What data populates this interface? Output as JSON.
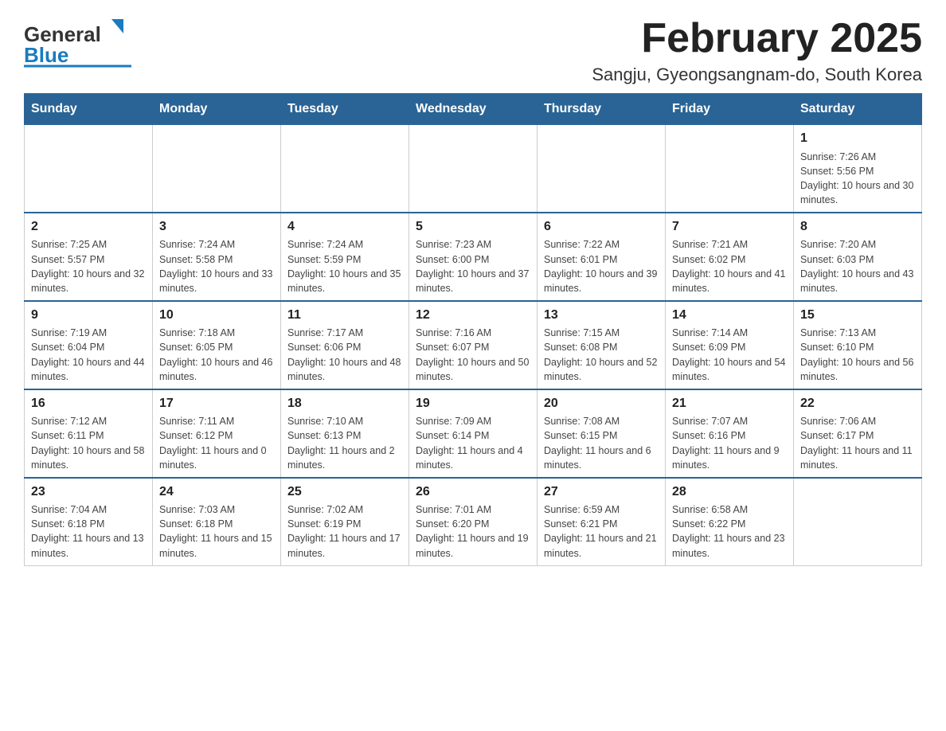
{
  "header": {
    "logo_general": "General",
    "logo_blue": "Blue",
    "title": "February 2025",
    "subtitle": "Sangju, Gyeongsangnam-do, South Korea"
  },
  "days_of_week": [
    "Sunday",
    "Monday",
    "Tuesday",
    "Wednesday",
    "Thursday",
    "Friday",
    "Saturday"
  ],
  "weeks": [
    {
      "days": [
        {
          "number": "",
          "sunrise": "",
          "sunset": "",
          "daylight": ""
        },
        {
          "number": "",
          "sunrise": "",
          "sunset": "",
          "daylight": ""
        },
        {
          "number": "",
          "sunrise": "",
          "sunset": "",
          "daylight": ""
        },
        {
          "number": "",
          "sunrise": "",
          "sunset": "",
          "daylight": ""
        },
        {
          "number": "",
          "sunrise": "",
          "sunset": "",
          "daylight": ""
        },
        {
          "number": "",
          "sunrise": "",
          "sunset": "",
          "daylight": ""
        },
        {
          "number": "1",
          "sunrise": "Sunrise: 7:26 AM",
          "sunset": "Sunset: 5:56 PM",
          "daylight": "Daylight: 10 hours and 30 minutes."
        }
      ]
    },
    {
      "days": [
        {
          "number": "2",
          "sunrise": "Sunrise: 7:25 AM",
          "sunset": "Sunset: 5:57 PM",
          "daylight": "Daylight: 10 hours and 32 minutes."
        },
        {
          "number": "3",
          "sunrise": "Sunrise: 7:24 AM",
          "sunset": "Sunset: 5:58 PM",
          "daylight": "Daylight: 10 hours and 33 minutes."
        },
        {
          "number": "4",
          "sunrise": "Sunrise: 7:24 AM",
          "sunset": "Sunset: 5:59 PM",
          "daylight": "Daylight: 10 hours and 35 minutes."
        },
        {
          "number": "5",
          "sunrise": "Sunrise: 7:23 AM",
          "sunset": "Sunset: 6:00 PM",
          "daylight": "Daylight: 10 hours and 37 minutes."
        },
        {
          "number": "6",
          "sunrise": "Sunrise: 7:22 AM",
          "sunset": "Sunset: 6:01 PM",
          "daylight": "Daylight: 10 hours and 39 minutes."
        },
        {
          "number": "7",
          "sunrise": "Sunrise: 7:21 AM",
          "sunset": "Sunset: 6:02 PM",
          "daylight": "Daylight: 10 hours and 41 minutes."
        },
        {
          "number": "8",
          "sunrise": "Sunrise: 7:20 AM",
          "sunset": "Sunset: 6:03 PM",
          "daylight": "Daylight: 10 hours and 43 minutes."
        }
      ]
    },
    {
      "days": [
        {
          "number": "9",
          "sunrise": "Sunrise: 7:19 AM",
          "sunset": "Sunset: 6:04 PM",
          "daylight": "Daylight: 10 hours and 44 minutes."
        },
        {
          "number": "10",
          "sunrise": "Sunrise: 7:18 AM",
          "sunset": "Sunset: 6:05 PM",
          "daylight": "Daylight: 10 hours and 46 minutes."
        },
        {
          "number": "11",
          "sunrise": "Sunrise: 7:17 AM",
          "sunset": "Sunset: 6:06 PM",
          "daylight": "Daylight: 10 hours and 48 minutes."
        },
        {
          "number": "12",
          "sunrise": "Sunrise: 7:16 AM",
          "sunset": "Sunset: 6:07 PM",
          "daylight": "Daylight: 10 hours and 50 minutes."
        },
        {
          "number": "13",
          "sunrise": "Sunrise: 7:15 AM",
          "sunset": "Sunset: 6:08 PM",
          "daylight": "Daylight: 10 hours and 52 minutes."
        },
        {
          "number": "14",
          "sunrise": "Sunrise: 7:14 AM",
          "sunset": "Sunset: 6:09 PM",
          "daylight": "Daylight: 10 hours and 54 minutes."
        },
        {
          "number": "15",
          "sunrise": "Sunrise: 7:13 AM",
          "sunset": "Sunset: 6:10 PM",
          "daylight": "Daylight: 10 hours and 56 minutes."
        }
      ]
    },
    {
      "days": [
        {
          "number": "16",
          "sunrise": "Sunrise: 7:12 AM",
          "sunset": "Sunset: 6:11 PM",
          "daylight": "Daylight: 10 hours and 58 minutes."
        },
        {
          "number": "17",
          "sunrise": "Sunrise: 7:11 AM",
          "sunset": "Sunset: 6:12 PM",
          "daylight": "Daylight: 11 hours and 0 minutes."
        },
        {
          "number": "18",
          "sunrise": "Sunrise: 7:10 AM",
          "sunset": "Sunset: 6:13 PM",
          "daylight": "Daylight: 11 hours and 2 minutes."
        },
        {
          "number": "19",
          "sunrise": "Sunrise: 7:09 AM",
          "sunset": "Sunset: 6:14 PM",
          "daylight": "Daylight: 11 hours and 4 minutes."
        },
        {
          "number": "20",
          "sunrise": "Sunrise: 7:08 AM",
          "sunset": "Sunset: 6:15 PM",
          "daylight": "Daylight: 11 hours and 6 minutes."
        },
        {
          "number": "21",
          "sunrise": "Sunrise: 7:07 AM",
          "sunset": "Sunset: 6:16 PM",
          "daylight": "Daylight: 11 hours and 9 minutes."
        },
        {
          "number": "22",
          "sunrise": "Sunrise: 7:06 AM",
          "sunset": "Sunset: 6:17 PM",
          "daylight": "Daylight: 11 hours and 11 minutes."
        }
      ]
    },
    {
      "days": [
        {
          "number": "23",
          "sunrise": "Sunrise: 7:04 AM",
          "sunset": "Sunset: 6:18 PM",
          "daylight": "Daylight: 11 hours and 13 minutes."
        },
        {
          "number": "24",
          "sunrise": "Sunrise: 7:03 AM",
          "sunset": "Sunset: 6:18 PM",
          "daylight": "Daylight: 11 hours and 15 minutes."
        },
        {
          "number": "25",
          "sunrise": "Sunrise: 7:02 AM",
          "sunset": "Sunset: 6:19 PM",
          "daylight": "Daylight: 11 hours and 17 minutes."
        },
        {
          "number": "26",
          "sunrise": "Sunrise: 7:01 AM",
          "sunset": "Sunset: 6:20 PM",
          "daylight": "Daylight: 11 hours and 19 minutes."
        },
        {
          "number": "27",
          "sunrise": "Sunrise: 6:59 AM",
          "sunset": "Sunset: 6:21 PM",
          "daylight": "Daylight: 11 hours and 21 minutes."
        },
        {
          "number": "28",
          "sunrise": "Sunrise: 6:58 AM",
          "sunset": "Sunset: 6:22 PM",
          "daylight": "Daylight: 11 hours and 23 minutes."
        },
        {
          "number": "",
          "sunrise": "",
          "sunset": "",
          "daylight": ""
        }
      ]
    }
  ]
}
